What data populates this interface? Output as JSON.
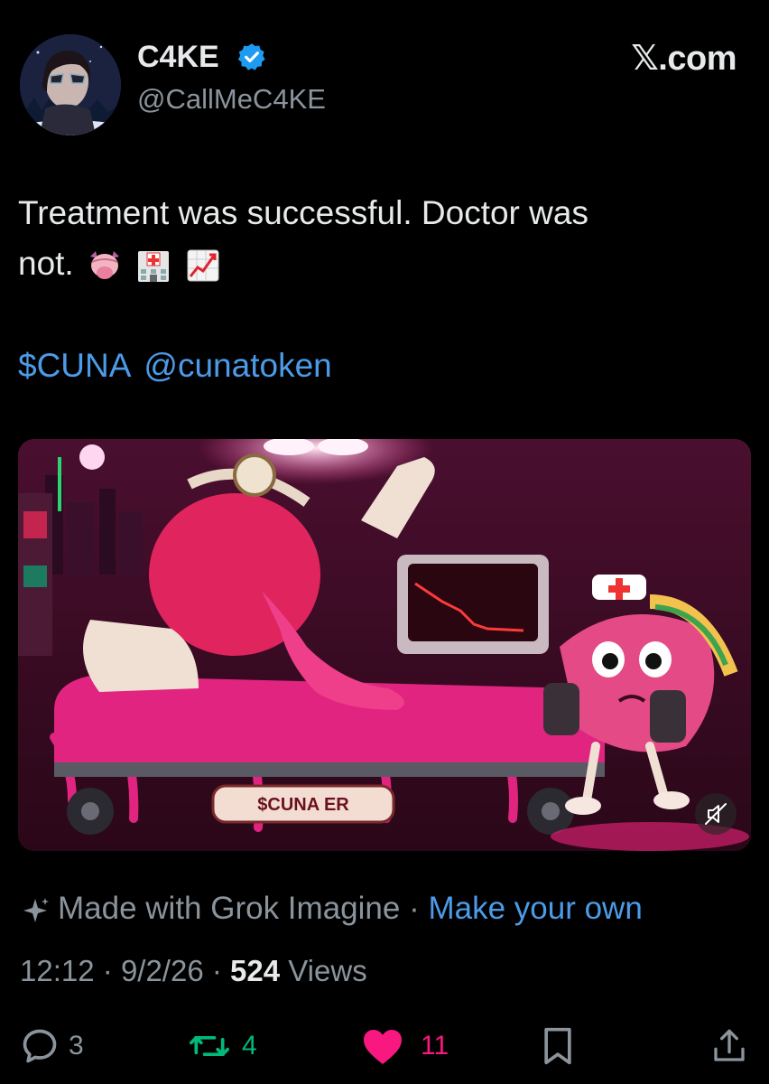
{
  "author": {
    "display_name": "C4KE",
    "handle": "@CallMeC4KE",
    "verified_icon": "verified-badge-icon",
    "avatar_icon": "avatar"
  },
  "brand": {
    "label": "𝕏.com"
  },
  "tweet": {
    "line1": "Treatment was successful. Doctor was",
    "line2": "not.",
    "emojis": [
      "tongue-face-emoji",
      "hospital-emoji",
      "chart-increasing-emoji"
    ],
    "cashtag": "$CUNA",
    "mention": "@cunatoken"
  },
  "media": {
    "sign_text": "$CUNA ER",
    "mute_icon": "muted-speaker-icon"
  },
  "grok": {
    "text": "Made with Grok Imagine",
    "separator": "·",
    "cta": "Make your own"
  },
  "meta": {
    "time": "12:12",
    "date": "9/2/26",
    "views_count": "524",
    "views_label": "Views",
    "separator": "·"
  },
  "actions": {
    "replies": "3",
    "reposts": "4",
    "likes": "11"
  },
  "colors": {
    "background": "#000000",
    "link": "#4c9be8",
    "muted_text": "#8b949c",
    "repost_green": "#00ba7c",
    "like_pink": "#f91880",
    "verified_blue": "#1d9bf0"
  }
}
